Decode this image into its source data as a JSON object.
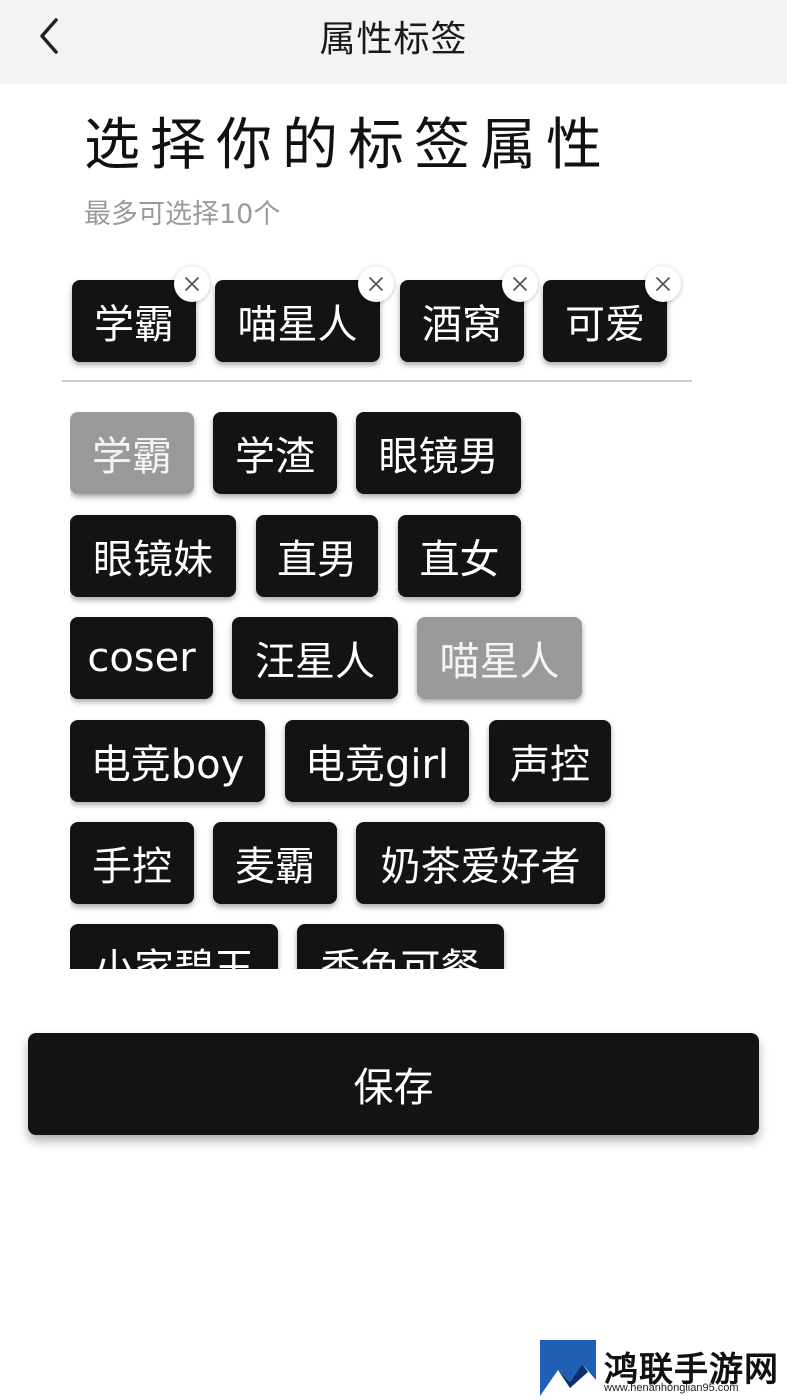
{
  "header": {
    "title": "属性标签",
    "back_icon": "chevron-left-icon"
  },
  "main": {
    "heading": "选择你的标签属性",
    "subheading": "最多可选择10个"
  },
  "selected_tags": [
    {
      "label": "学霸"
    },
    {
      "label": "喵星人"
    },
    {
      "label": "酒窝"
    },
    {
      "label": "可爱"
    }
  ],
  "tag_pool": [
    {
      "label": "学霸",
      "selected": true
    },
    {
      "label": "学渣",
      "selected": false
    },
    {
      "label": "眼镜男",
      "selected": false
    },
    {
      "label": "眼镜妹",
      "selected": false
    },
    {
      "label": "直男",
      "selected": false
    },
    {
      "label": "直女",
      "selected": false
    },
    {
      "label": "coser",
      "selected": false
    },
    {
      "label": "汪星人",
      "selected": false
    },
    {
      "label": "喵星人",
      "selected": true
    },
    {
      "label": "电竞boy",
      "selected": false
    },
    {
      "label": "电竞girl",
      "selected": false
    },
    {
      "label": "声控",
      "selected": false
    },
    {
      "label": "手控",
      "selected": false
    },
    {
      "label": "麦霸",
      "selected": false
    },
    {
      "label": "奶茶爱好者",
      "selected": false
    },
    {
      "label": "小家碧玉",
      "selected": false
    },
    {
      "label": "秀色可餐",
      "selected": false
    }
  ],
  "actions": {
    "save_label": "保存"
  },
  "watermark": {
    "name": "鸿联手游网",
    "url": "www.henanhonglian95.com"
  },
  "colors": {
    "chip_bg": "#141212",
    "chip_selected_bg": "#9a9a9a",
    "header_bg": "#f3f3f3"
  }
}
